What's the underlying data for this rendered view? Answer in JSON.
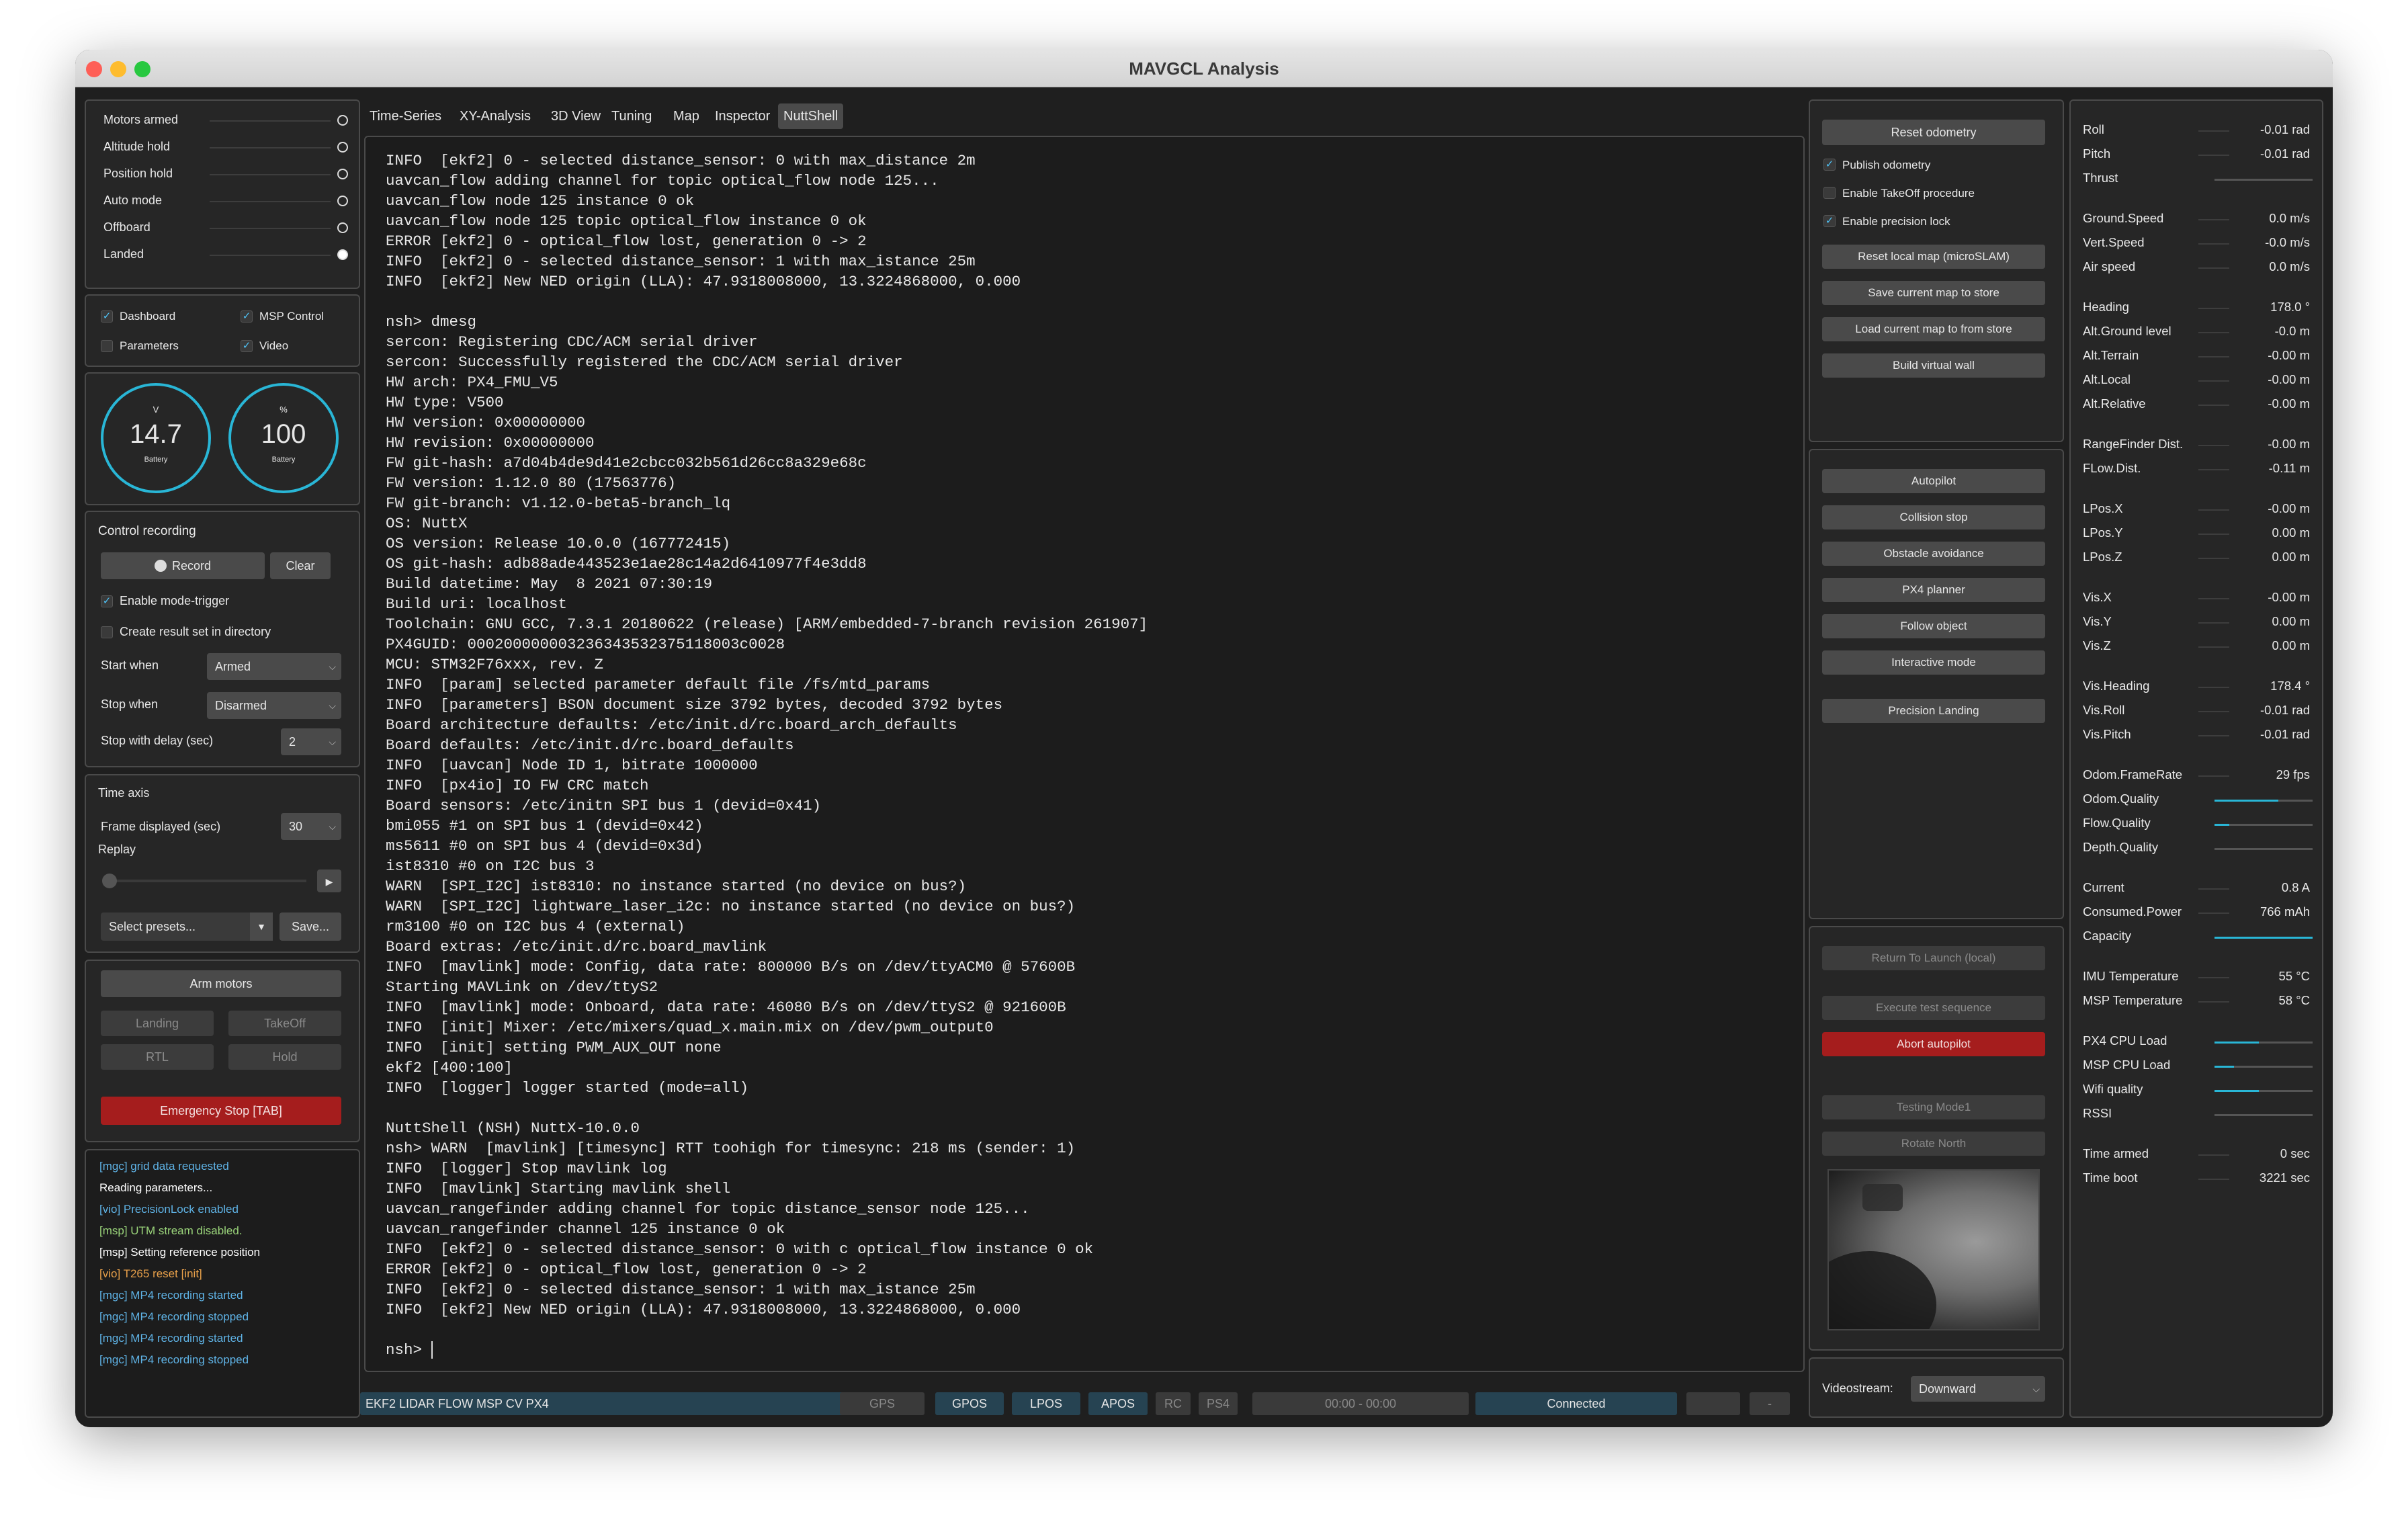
{
  "window": {
    "title": "MAVGCL Analysis"
  },
  "flags": [
    {
      "label": "Motors armed",
      "on": false
    },
    {
      "label": "Altitude hold",
      "on": false
    },
    {
      "label": "Position hold",
      "on": false
    },
    {
      "label": "Auto mode",
      "on": false
    },
    {
      "label": "Offboard",
      "on": false
    },
    {
      "label": "Landed",
      "on": true
    }
  ],
  "views": [
    {
      "label": "Dashboard",
      "checked": true
    },
    {
      "label": "MSP Control",
      "checked": true
    },
    {
      "label": "Parameters",
      "checked": false
    },
    {
      "label": "Video",
      "checked": true
    }
  ],
  "gauges": [
    {
      "unit": "V",
      "value": "14.7",
      "caption": "Battery"
    },
    {
      "unit": "%",
      "value": "100",
      "caption": "Battery"
    }
  ],
  "recording": {
    "title": "Control recording",
    "record_label": "Record",
    "clear_label": "Clear",
    "mode_trigger_label": "Enable mode-trigger",
    "mode_trigger_checked": true,
    "result_dir_label": "Create result set in directory",
    "result_dir_checked": false,
    "start_when_label": "Start when",
    "start_when_value": "Armed",
    "stop_when_label": "Stop when",
    "stop_when_value": "Disarmed",
    "stop_delay_label": "Stop with delay (sec)",
    "stop_delay_value": "2"
  },
  "timeaxis": {
    "title": "Time axis",
    "frame_label": "Frame displayed (sec)",
    "frame_value": "30",
    "replay_label": "Replay",
    "presets_placeholder": "Select presets...",
    "save_label": "Save..."
  },
  "actions": {
    "arm": "Arm motors",
    "landing": "Landing",
    "takeoff": "TakeOff",
    "rtl": "RTL",
    "hold": "Hold",
    "estop": "Emergency Stop [TAB]"
  },
  "messages": [
    {
      "text": "[mgc] grid data requested",
      "color": "#5fb3e6"
    },
    {
      "text": "Reading parameters...",
      "color": "#ffffff"
    },
    {
      "text": "[vio] PrecisionLock enabled",
      "color": "#5fb3e6"
    },
    {
      "text": "[msp] UTM stream disabled.",
      "color": "#9ad47a"
    },
    {
      "text": "[msp] Setting reference position",
      "color": "#ffffff"
    },
    {
      "text": "[vio] T265 reset [init]",
      "color": "#e8a04a"
    },
    {
      "text": "[mgc] MP4 recording started",
      "color": "#5fb3e6"
    },
    {
      "text": "[mgc] MP4 recording stopped",
      "color": "#5fb3e6"
    },
    {
      "text": "[mgc] MP4 recording started",
      "color": "#5fb3e6"
    },
    {
      "text": "[mgc] MP4 recording stopped",
      "color": "#5fb3e6"
    }
  ],
  "tabs": [
    {
      "label": "Time-Series",
      "active": false
    },
    {
      "label": "XY-Analysis",
      "active": false
    },
    {
      "label": "3D View",
      "active": false
    },
    {
      "label": "Tuning",
      "active": false
    },
    {
      "label": "Map",
      "active": false
    },
    {
      "label": "Inspector",
      "active": false
    },
    {
      "label": "NuttShell",
      "active": true
    }
  ],
  "terminal": {
    "lines": [
      "INFO  [ekf2] 0 - selected distance_sensor: 0 with max_distance 2m",
      "uavcan_flow adding channel for topic optical_flow node 125...",
      "uavcan_flow node 125 instance 0 ok",
      "uavcan_flow node 125 topic optical_flow instance 0 ok",
      "ERROR [ekf2] 0 - optical_flow lost, generation 0 -> 2",
      "INFO  [ekf2] 0 - selected distance_sensor: 1 with max_istance 25m",
      "INFO  [ekf2] New NED origin (LLA): 47.9318008000, 13.3224868000, 0.000",
      "",
      "nsh> dmesg",
      "sercon: Registering CDC/ACM serial driver",
      "sercon: Successfully registered the CDC/ACM serial driver",
      "HW arch: PX4_FMU_V5",
      "HW type: V500",
      "HW version: 0x00000000",
      "HW revision: 0x00000000",
      "FW git-hash: a7d04b4de9d41e2cbcc032b561d26cc8a329e68c",
      "FW version: 1.12.0 80 (17563776)",
      "FW git-branch: v1.12.0-beta5-branch_lq",
      "OS: NuttX",
      "OS version: Release 10.0.0 (167772415)",
      "OS git-hash: adb88ade443523e1ae28c14a2d6410977f4e3dd8",
      "Build datetime: May  8 2021 07:30:19",
      "Build uri: localhost",
      "Toolchain: GNU GCC, 7.3.1 20180622 (release) [ARM/embedded-7-branch revision 261907]",
      "PX4GUID: 000200000003236343532375118003c0028",
      "MCU: STM32F76xxx, rev. Z",
      "INFO  [param] selected parameter default file /fs/mtd_params",
      "INFO  [parameters] BSON document size 3792 bytes, decoded 3792 bytes",
      "Board architecture defaults: /etc/init.d/rc.board_arch_defaults",
      "Board defaults: /etc/init.d/rc.board_defaults",
      "INFO  [uavcan] Node ID 1, bitrate 1000000",
      "INFO  [px4io] IO FW CRC match",
      "Board sensors: /etc/initn SPI bus 1 (devid=0x41)",
      "bmi055 #1 on SPI bus 1 (devid=0x42)",
      "ms5611 #0 on SPI bus 4 (devid=0x3d)",
      "ist8310 #0 on I2C bus 3",
      "WARN  [SPI_I2C] ist8310: no instance started (no device on bus?)",
      "WARN  [SPI_I2C] lightware_laser_i2c: no instance started (no device on bus?)",
      "rm3100 #0 on I2C bus 4 (external)",
      "Board extras: /etc/init.d/rc.board_mavlink",
      "INFO  [mavlink] mode: Config, data rate: 800000 B/s on /dev/ttyACM0 @ 57600B",
      "Starting MAVLink on /dev/ttyS2",
      "INFO  [mavlink] mode: Onboard, data rate: 46080 B/s on /dev/ttyS2 @ 921600B",
      "INFO  [init] Mixer: /etc/mixers/quad_x.main.mix on /dev/pwm_output0",
      "INFO  [init] setting PWM_AUX_OUT none",
      "ekf2 [400:100]",
      "INFO  [logger] logger started (mode=all)",
      "",
      "NuttShell (NSH) NuttX-10.0.0",
      "nsh> WARN  [mavlink] [timesync] RTT toohigh for timesync: 218 ms (sender: 1)",
      "INFO  [logger] Stop mavlink log",
      "INFO  [mavlink] Starting mavlink shell",
      "uavcan_rangefinder adding channel for topic distance_sensor node 125...",
      "uavcan_rangefinder channel 125 instance 0 ok",
      "INFO  [ekf2] 0 - selected distance_sensor: 0 with c optical_flow instance 0 ok",
      "ERROR [ekf2] 0 - optical_flow lost, generation 0 -> 2",
      "INFO  [ekf2] 0 - selected distance_sensor: 1 with max_istance 25m",
      "INFO  [ekf2] New NED origin (LLA): 47.9318008000, 13.3224868000, 0.000"
    ],
    "prompt": "nsh> "
  },
  "msp_top": {
    "reset_odometry": "Reset odometry",
    "publish_odometry": {
      "label": "Publish odometry",
      "checked": true
    },
    "takeoff_procedure": {
      "label": "Enable TakeOff procedure",
      "checked": false
    },
    "precision_lock": {
      "label": "Enable precision lock",
      "checked": true
    },
    "reset_local_map": "Reset local map (microSLAM)",
    "save_map": "Save current map to store",
    "load_map": "Load current map to from store",
    "build_wall": "Build virtual wall"
  },
  "msp_mid": [
    "Autopilot",
    "Collision stop",
    "Obstacle avoidance",
    "PX4 planner",
    "Follow object",
    "Interactive mode",
    "Precision Landing"
  ],
  "msp_bottom": {
    "rtl_local": "Return To Launch (local)",
    "test_sequence": "Execute test sequence",
    "abort": "Abort autopilot",
    "testing_mode": "Testing Mode1",
    "rotate_north": "Rotate North"
  },
  "videostream": {
    "label": "Videostream:",
    "value": "Downward"
  },
  "telemetry": [
    {
      "label": "Roll",
      "value": "-0.01 rad"
    },
    {
      "label": "Pitch",
      "value": "-0.01 rad"
    },
    {
      "label": "Thrust",
      "value": "",
      "bar": 0.0
    },
    {
      "label": "Ground.Speed",
      "value": "0.0 m/s"
    },
    {
      "label": "Vert.Speed",
      "value": "-0.0 m/s"
    },
    {
      "label": "Air speed",
      "value": "0.0 m/s"
    },
    {
      "label": "Heading",
      "value": "178.0 °"
    },
    {
      "label": "Alt.Ground level",
      "value": "-0.0 m"
    },
    {
      "label": "Alt.Terrain",
      "value": "-0.00 m"
    },
    {
      "label": "Alt.Local",
      "value": "-0.00 m"
    },
    {
      "label": "Alt.Relative",
      "value": "-0.00 m"
    },
    {
      "label": "RangeFinder Dist.",
      "value": "-0.00 m"
    },
    {
      "label": "FLow.Dist.",
      "value": "-0.11 m"
    },
    {
      "label": "LPos.X",
      "value": "-0.00 m"
    },
    {
      "label": "LPos.Y",
      "value": "0.00 m"
    },
    {
      "label": "LPos.Z",
      "value": "0.00 m"
    },
    {
      "label": "Vis.X",
      "value": "-0.00 m"
    },
    {
      "label": "Vis.Y",
      "value": "0.00 m"
    },
    {
      "label": "Vis.Z",
      "value": "0.00 m"
    },
    {
      "label": "Vis.Heading",
      "value": "178.4 °"
    },
    {
      "label": "Vis.Roll",
      "value": "-0.01 rad"
    },
    {
      "label": "Vis.Pitch",
      "value": "-0.01 rad"
    },
    {
      "label": "Odom.FrameRate",
      "value": "29 fps"
    },
    {
      "label": "Odom.Quality",
      "value": "",
      "bar": 0.65
    },
    {
      "label": "Flow.Quality",
      "value": "",
      "bar": 0.15
    },
    {
      "label": "Depth.Quality",
      "value": "",
      "bar": 0.0
    },
    {
      "label": "Current",
      "value": "0.8 A"
    },
    {
      "label": "Consumed.Power",
      "value": "766 mAh"
    },
    {
      "label": "Capacity",
      "value": "",
      "bar": 1.0
    },
    {
      "label": "IMU Temperature",
      "value": "55 °C"
    },
    {
      "label": "MSP Temperature",
      "value": "58 °C"
    },
    {
      "label": "PX4 CPU Load",
      "value": "",
      "bar": 0.45
    },
    {
      "label": "MSP CPU Load",
      "value": "",
      "bar": 0.2
    },
    {
      "label": "Wifi quality",
      "value": "",
      "bar": 0.45
    },
    {
      "label": "RSSI",
      "value": "",
      "bar": 0.0
    },
    {
      "label": "Time armed",
      "value": "0 sec"
    },
    {
      "label": "Time boot",
      "value": "3221 sec"
    }
  ],
  "statusbar": {
    "source": "EKF2 LIDAR FLOW MSP CV PX4",
    "gps": "GPS",
    "gpos": "GPOS",
    "lpos": "LPOS",
    "apos": "APOS",
    "rc": "RC",
    "ps4": "PS4",
    "time": "00:00 - 00:00",
    "connection": "Connected",
    "dash": "-"
  },
  "colors": {
    "accent": "#29b6d6",
    "danger": "#a51d1d",
    "panel": "#262626"
  }
}
